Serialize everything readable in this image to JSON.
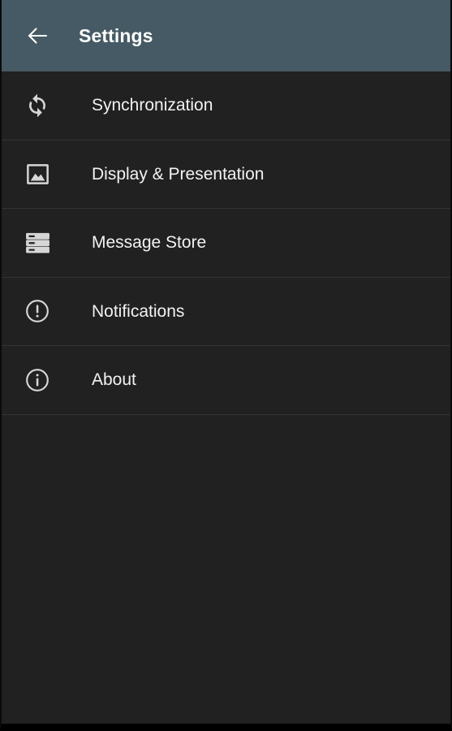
{
  "window": {
    "background_color": "#212121",
    "accent_color": "#455a64"
  },
  "appbar": {
    "title": "Settings",
    "back_icon": "arrow-left-icon",
    "background_color": "#455a64",
    "text_color": "#ffffff"
  },
  "settings": {
    "items": [
      {
        "label": "Synchronization",
        "icon": "sync-icon"
      },
      {
        "label": "Display & Presentation",
        "icon": "image-icon"
      },
      {
        "label": "Message Store",
        "icon": "storage-icon"
      },
      {
        "label": "Notifications",
        "icon": "exclamation-circle-icon"
      },
      {
        "label": "About",
        "icon": "info-circle-icon"
      }
    ]
  }
}
